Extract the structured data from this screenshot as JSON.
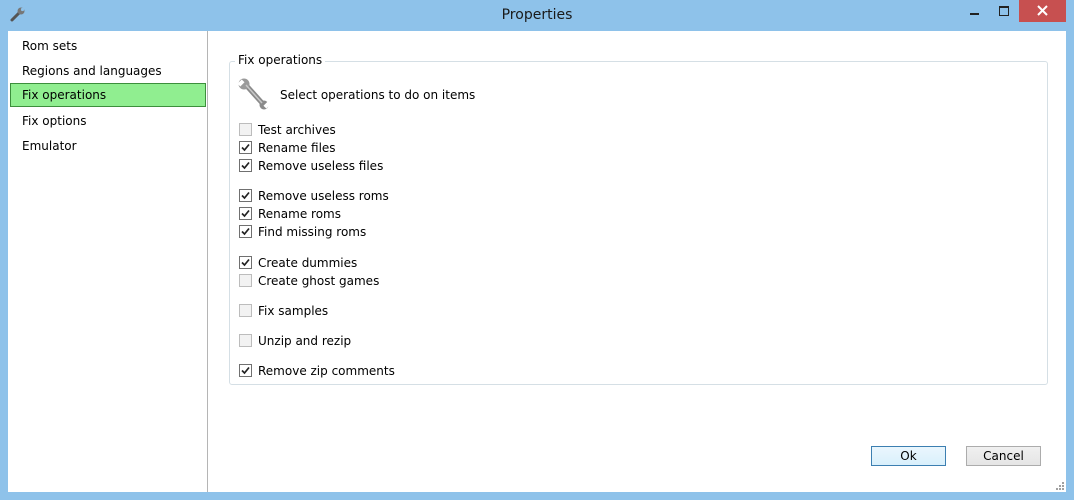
{
  "window": {
    "title": "Properties",
    "app_icon": "wrench-app-icon",
    "controls": [
      "minimize-icon",
      "maximize-icon",
      "close-icon"
    ]
  },
  "sidebar": {
    "items": [
      {
        "label": "Rom sets",
        "active": false
      },
      {
        "label": "Regions and languages",
        "active": false
      },
      {
        "label": "Fix operations",
        "active": true
      },
      {
        "label": "Fix options",
        "active": false
      },
      {
        "label": "Emulator",
        "active": false
      }
    ]
  },
  "group": {
    "title": "Fix operations",
    "icon": "wrench-icon",
    "description": "Select operations to do on items"
  },
  "options": [
    {
      "label": "Test archives",
      "checked": false
    },
    {
      "label": "Rename files",
      "checked": true
    },
    {
      "label": "Remove useless files",
      "checked": true
    },
    {
      "label": "Remove useless roms",
      "checked": true
    },
    {
      "label": "Rename roms",
      "checked": true
    },
    {
      "label": "Find missing roms",
      "checked": true
    },
    {
      "label": "Create dummies",
      "checked": true
    },
    {
      "label": "Create ghost games",
      "checked": false
    },
    {
      "label": "Fix samples",
      "checked": false
    },
    {
      "label": "Unzip and rezip",
      "checked": false
    },
    {
      "label": "Remove zip comments",
      "checked": true
    }
  ],
  "buttons": {
    "ok": "Ok",
    "cancel": "Cancel"
  },
  "colors": {
    "frame": "#8ec2ea",
    "active_item": "#90ee90",
    "close_button": "#c75050"
  }
}
